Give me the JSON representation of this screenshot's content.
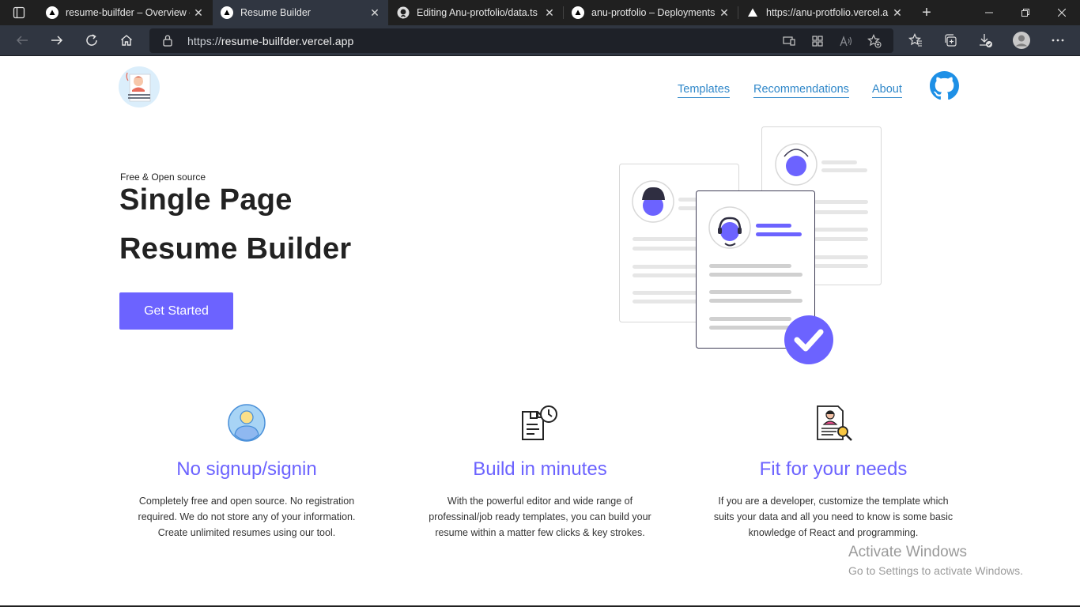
{
  "browser": {
    "tabs": [
      {
        "label": "resume-builfder – Overview – Vercel",
        "icon": "vercel-icon",
        "active": false
      },
      {
        "label": "Resume Builder",
        "icon": "vercel-icon",
        "active": true
      },
      {
        "label": "Editing Anu-protfolio/data.ts",
        "icon": "github-icon",
        "active": false
      },
      {
        "label": "anu-protfolio – Deployments",
        "icon": "vercel-icon",
        "active": false
      },
      {
        "label": "https://anu-protfolio.vercel.app",
        "icon": "vercel-icon",
        "active": false
      }
    ],
    "address": {
      "scheme": "https://",
      "host": "resume-builfder.vercel.app"
    }
  },
  "page": {
    "nav": {
      "templates": "Templates",
      "recommendations": "Recommendations",
      "about": "About"
    },
    "hero": {
      "kicker": "Free & Open source",
      "title_line1": "Single Page",
      "title_line2": "Resume Builder",
      "cta": "Get Started"
    },
    "features": [
      {
        "title": "No signup/signin",
        "icon": "user-avatar-icon",
        "line1": "Completely free and open source. No registration",
        "line2": "required. We do not store any of your information.",
        "line3": "Create unlimited resumes using our tool."
      },
      {
        "title": "Build in minutes",
        "icon": "document-clock-icon",
        "line1": "With the powerful editor and wide range of",
        "line2": "professinal/job ready templates, you can build your",
        "line3": "resume within a matter few clicks & key strokes."
      },
      {
        "title": "Fit for your needs",
        "icon": "resume-search-icon",
        "line1": "If you are a developer, customize the template which",
        "line2": "suits your data and all you need to know is some basic",
        "line3": "knowledge of React and programming."
      }
    ],
    "watermark": {
      "title": "Activate Windows",
      "subtitle": "Go to Settings to activate Windows."
    }
  },
  "colors": {
    "accent": "#6c63ff",
    "link": "#2f87c9",
    "tabbar": "#202020",
    "toolbar": "#303641"
  }
}
